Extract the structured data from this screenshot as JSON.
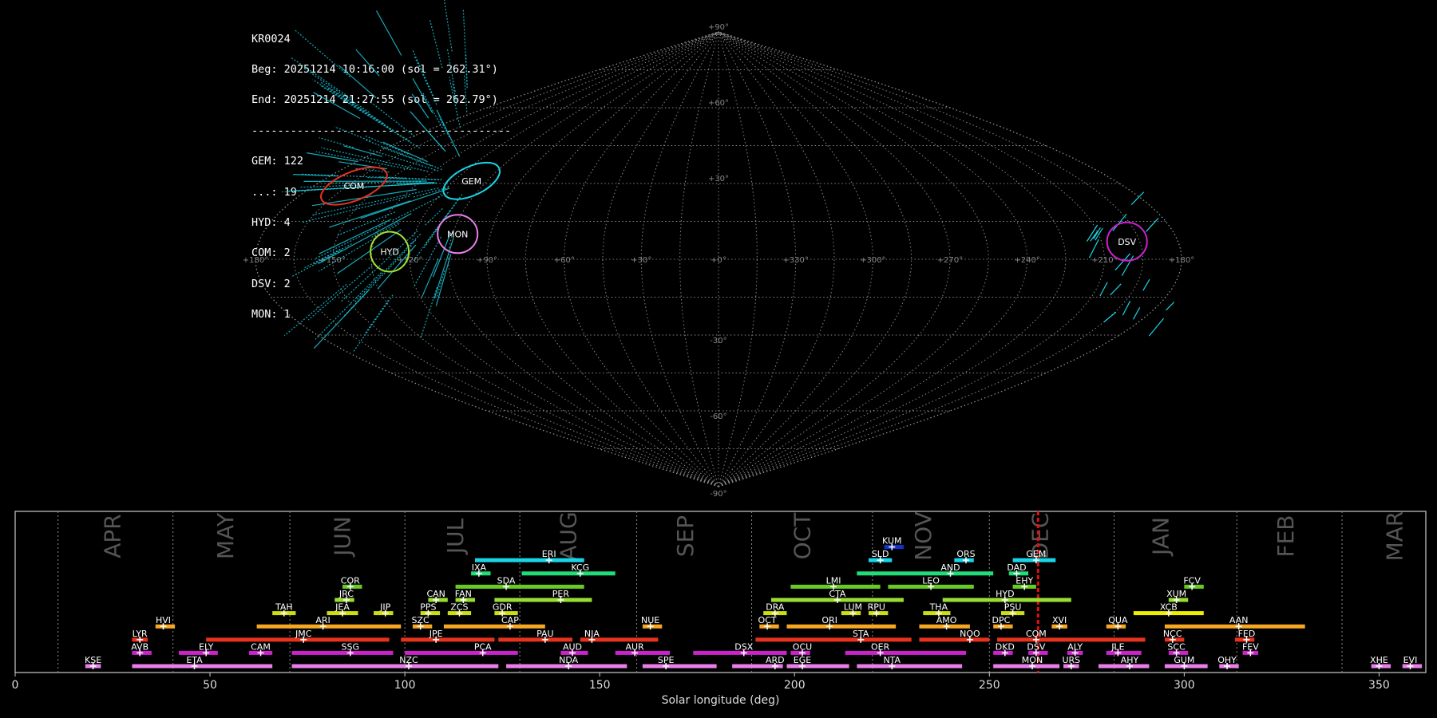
{
  "summary": {
    "camera": "KR0024",
    "beg": "Beg: 20251214 10:16:00 (sol = 262.31°)",
    "end": "End: 20251214 21:27:55 (sol = 262.79°)",
    "separator": "----------------------------------------",
    "counts": [
      "GEM: 122",
      "...: 19",
      "HYD: 4",
      "COM: 2",
      "DSV: 2",
      "MON: 1"
    ]
  },
  "sky_map": {
    "lat_labels": [
      "+90°",
      "+60°",
      "+30°",
      "-30°",
      "-60°",
      "-90°"
    ],
    "lon_labels": [
      "+180°",
      "+150°",
      "+120°",
      "+90°",
      "+60°",
      "+30°",
      "+0°",
      "+330°",
      "+300°",
      "+270°",
      "+240°",
      "+210°",
      "+180°"
    ],
    "radiants": [
      {
        "code": "COM",
        "ra": 162,
        "dec": 29,
        "color": "#e8321e"
      },
      {
        "code": "GEM",
        "ra": 112,
        "dec": 31,
        "color": "#19d4e6"
      },
      {
        "code": "MON",
        "ra": 103,
        "dec": 10,
        "color": "#e87ee8"
      },
      {
        "code": "HYD",
        "ra": 128,
        "dec": 3,
        "color": "#a6e22e"
      },
      {
        "code": "DSV",
        "ra": 200,
        "dec": 7,
        "color": "#cc22cc"
      }
    ]
  },
  "chart_data": {
    "type": "bar",
    "xlabel": "Solar longitude (deg)",
    "xlim": [
      0,
      362
    ],
    "x_ticks": [
      0,
      50,
      100,
      150,
      200,
      250,
      300,
      350
    ],
    "current_sol": 262.5,
    "months": [
      {
        "label": "APR",
        "x": 25
      },
      {
        "label": "MAY",
        "x": 54
      },
      {
        "label": "JUN",
        "x": 84
      },
      {
        "label": "JUL",
        "x": 113
      },
      {
        "label": "AUG",
        "x": 142
      },
      {
        "label": "SEP",
        "x": 172
      },
      {
        "label": "OCT",
        "x": 202
      },
      {
        "label": "NOV",
        "x": 233
      },
      {
        "label": "DEC",
        "x": 263
      },
      {
        "label": "JAN",
        "x": 294
      },
      {
        "label": "FEB",
        "x": 326
      },
      {
        "label": "MAR",
        "x": 354
      }
    ],
    "month_dividers": [
      11,
      40.5,
      70.5,
      100,
      129.5,
      159.5,
      189,
      220,
      250,
      282,
      313.5,
      340.5
    ],
    "showers": [
      {
        "code": "KUM",
        "start": 223,
        "end": 228,
        "peak": 225,
        "row": 10,
        "color": "#1133cc"
      },
      {
        "code": "ERI",
        "start": 118,
        "end": 146,
        "peak": 137,
        "row": 9,
        "color": "#19d4e6"
      },
      {
        "code": "SLD",
        "start": 219,
        "end": 225,
        "peak": 222,
        "row": 9,
        "color": "#19d4e6"
      },
      {
        "code": "ORS",
        "start": 241,
        "end": 246,
        "peak": 244,
        "row": 9,
        "color": "#19d4e6"
      },
      {
        "code": "GEM",
        "start": 256,
        "end": 267,
        "peak": 262,
        "row": 9,
        "color": "#19d4e6"
      },
      {
        "code": "IXA",
        "start": 117,
        "end": 122,
        "peak": 119,
        "row": 8,
        "color": "#22dd77"
      },
      {
        "code": "KCG",
        "start": 130,
        "end": 154,
        "peak": 145,
        "row": 8,
        "color": "#22dd77"
      },
      {
        "code": "AND",
        "start": 216,
        "end": 251,
        "peak": 240,
        "row": 8,
        "color": "#22dd77"
      },
      {
        "code": "DAD",
        "start": 255,
        "end": 260,
        "peak": 257,
        "row": 8,
        "color": "#22dd77"
      },
      {
        "code": "COR",
        "start": 84,
        "end": 89,
        "peak": 86,
        "row": 7,
        "color": "#66cc22"
      },
      {
        "code": "SDA",
        "start": 113,
        "end": 146,
        "peak": 126,
        "row": 7,
        "color": "#66cc22"
      },
      {
        "code": "LMI",
        "start": 199,
        "end": 222,
        "peak": 210,
        "row": 7,
        "color": "#66cc22"
      },
      {
        "code": "LEO",
        "start": 224,
        "end": 246,
        "peak": 235,
        "row": 7,
        "color": "#66cc22"
      },
      {
        "code": "EHY",
        "start": 256,
        "end": 262,
        "peak": 259,
        "row": 7,
        "color": "#66cc22"
      },
      {
        "code": "FCV",
        "start": 300,
        "end": 305,
        "peak": 302,
        "row": 7,
        "color": "#66cc22"
      },
      {
        "code": "JRC",
        "start": 82,
        "end": 87,
        "peak": 85,
        "row": 6,
        "color": "#99dd33"
      },
      {
        "code": "CAN",
        "start": 106,
        "end": 111,
        "peak": 108,
        "row": 6,
        "color": "#99dd33"
      },
      {
        "code": "FAN",
        "start": 113,
        "end": 118,
        "peak": 115,
        "row": 6,
        "color": "#99dd33"
      },
      {
        "code": "PER",
        "start": 123,
        "end": 148,
        "peak": 140,
        "row": 6,
        "color": "#99dd33"
      },
      {
        "code": "CTA",
        "start": 194,
        "end": 228,
        "peak": 211,
        "row": 6,
        "color": "#99dd33"
      },
      {
        "code": "HYD",
        "start": 238,
        "end": 271,
        "peak": 254,
        "row": 6,
        "color": "#99dd33"
      },
      {
        "code": "XUM",
        "start": 296,
        "end": 301,
        "peak": 298,
        "row": 6,
        "color": "#99dd33"
      },
      {
        "code": "TAH",
        "start": 66,
        "end": 72,
        "peak": 69,
        "row": 5,
        "color": "#ccdd11"
      },
      {
        "code": "JEA",
        "start": 80,
        "end": 88,
        "peak": 84,
        "row": 5,
        "color": "#ccdd11"
      },
      {
        "code": "JIP",
        "start": 92,
        "end": 97,
        "peak": 95,
        "row": 5,
        "color": "#ccdd11"
      },
      {
        "code": "PPS",
        "start": 104,
        "end": 109,
        "peak": 106,
        "row": 5,
        "color": "#ccdd11"
      },
      {
        "code": "ZCS",
        "start": 111,
        "end": 117,
        "peak": 114,
        "row": 5,
        "color": "#ccdd11"
      },
      {
        "code": "GDR",
        "start": 123,
        "end": 129,
        "peak": 125,
        "row": 5,
        "color": "#ccdd11"
      },
      {
        "code": "DRA",
        "start": 192,
        "end": 198,
        "peak": 195,
        "row": 5,
        "color": "#ccdd11"
      },
      {
        "code": "LUM",
        "start": 212,
        "end": 217,
        "peak": 215,
        "row": 5,
        "color": "#ccdd11"
      },
      {
        "code": "RPU",
        "start": 219,
        "end": 224,
        "peak": 221,
        "row": 5,
        "color": "#ccdd11"
      },
      {
        "code": "THA",
        "start": 233,
        "end": 240,
        "peak": 237,
        "row": 5,
        "color": "#ccdd11"
      },
      {
        "code": "PSU",
        "start": 253,
        "end": 259,
        "peak": 256,
        "row": 5,
        "color": "#ccdd11"
      },
      {
        "code": "XCB",
        "start": 287,
        "end": 305,
        "peak": 296,
        "row": 5,
        "color": "#eeee00"
      },
      {
        "code": "HVI",
        "start": 36,
        "end": 41,
        "peak": 38,
        "row": 4,
        "color": "#f5a623"
      },
      {
        "code": "ARI",
        "start": 62,
        "end": 99,
        "peak": 79,
        "row": 4,
        "color": "#f5a623"
      },
      {
        "code": "SZC",
        "start": 102,
        "end": 107,
        "peak": 104,
        "row": 4,
        "color": "#f5a623"
      },
      {
        "code": "CAP",
        "start": 110,
        "end": 136,
        "peak": 127,
        "row": 4,
        "color": "#f5a623"
      },
      {
        "code": "NUE",
        "start": 161,
        "end": 166,
        "peak": 163,
        "row": 4,
        "color": "#f5a623"
      },
      {
        "code": "OCT",
        "start": 191,
        "end": 196,
        "peak": 193,
        "row": 4,
        "color": "#f5a623"
      },
      {
        "code": "ORI",
        "start": 198,
        "end": 226,
        "peak": 209,
        "row": 4,
        "color": "#f5a623"
      },
      {
        "code": "AMO",
        "start": 232,
        "end": 245,
        "peak": 239,
        "row": 4,
        "color": "#f5a623"
      },
      {
        "code": "DPC",
        "start": 251,
        "end": 256,
        "peak": 253,
        "row": 4,
        "color": "#f5a623"
      },
      {
        "code": "XVI",
        "start": 266,
        "end": 270,
        "peak": 268,
        "row": 4,
        "color": "#f5a623"
      },
      {
        "code": "QUA",
        "start": 280,
        "end": 285,
        "peak": 283,
        "row": 4,
        "color": "#f5a623"
      },
      {
        "code": "AAN",
        "start": 295,
        "end": 331,
        "peak": 314,
        "row": 4,
        "color": "#f5a623"
      },
      {
        "code": "LYR",
        "start": 30,
        "end": 34,
        "peak": 32,
        "row": 3,
        "color": "#e8321e"
      },
      {
        "code": "JMC",
        "start": 49,
        "end": 96,
        "peak": 74,
        "row": 3,
        "color": "#e8321e"
      },
      {
        "code": "JPE",
        "start": 99,
        "end": 123,
        "peak": 108,
        "row": 3,
        "color": "#e8321e"
      },
      {
        "code": "PAU",
        "start": 124,
        "end": 143,
        "peak": 136,
        "row": 3,
        "color": "#e8321e"
      },
      {
        "code": "NIA",
        "start": 145,
        "end": 165,
        "peak": 148,
        "row": 3,
        "color": "#e8321e"
      },
      {
        "code": "STA",
        "start": 190,
        "end": 230,
        "peak": 217,
        "row": 3,
        "color": "#e8321e"
      },
      {
        "code": "NOO",
        "start": 232,
        "end": 250,
        "peak": 245,
        "row": 3,
        "color": "#e8321e"
      },
      {
        "code": "COM",
        "start": 252,
        "end": 290,
        "peak": 262,
        "row": 3,
        "color": "#e8321e"
      },
      {
        "code": "NCC",
        "start": 295,
        "end": 300,
        "peak": 297,
        "row": 3,
        "color": "#e8321e"
      },
      {
        "code": "FED",
        "start": 313,
        "end": 318,
        "peak": 316,
        "row": 3,
        "color": "#e8321e"
      },
      {
        "code": "AVB",
        "start": 30,
        "end": 35,
        "peak": 32,
        "row": 2,
        "color": "#cc22cc"
      },
      {
        "code": "ELY",
        "start": 42,
        "end": 52,
        "peak": 49,
        "row": 2,
        "color": "#cc22cc"
      },
      {
        "code": "CAM",
        "start": 60,
        "end": 66,
        "peak": 63,
        "row": 2,
        "color": "#cc22cc"
      },
      {
        "code": "SSG",
        "start": 71,
        "end": 97,
        "peak": 86,
        "row": 2,
        "color": "#cc22cc"
      },
      {
        "code": "PCA",
        "start": 100,
        "end": 129,
        "peak": 120,
        "row": 2,
        "color": "#cc22cc"
      },
      {
        "code": "AUD",
        "start": 140,
        "end": 147,
        "peak": 143,
        "row": 2,
        "color": "#cc22cc"
      },
      {
        "code": "AUR",
        "start": 154,
        "end": 168,
        "peak": 159,
        "row": 2,
        "color": "#cc22cc"
      },
      {
        "code": "DSX",
        "start": 174,
        "end": 198,
        "peak": 187,
        "row": 2,
        "color": "#cc22cc"
      },
      {
        "code": "OCU",
        "start": 199,
        "end": 204,
        "peak": 202,
        "row": 2,
        "color": "#cc22cc"
      },
      {
        "code": "OER",
        "start": 213,
        "end": 244,
        "peak": 222,
        "row": 2,
        "color": "#cc22cc"
      },
      {
        "code": "DKD",
        "start": 251,
        "end": 256,
        "peak": 254,
        "row": 2,
        "color": "#cc22cc"
      },
      {
        "code": "DSV",
        "start": 260,
        "end": 265,
        "peak": 262,
        "row": 2,
        "color": "#cc22cc"
      },
      {
        "code": "ALY",
        "start": 270,
        "end": 274,
        "peak": 272,
        "row": 2,
        "color": "#cc22cc"
      },
      {
        "code": "JLE",
        "start": 280,
        "end": 289,
        "peak": 283,
        "row": 2,
        "color": "#cc22cc"
      },
      {
        "code": "SCC",
        "start": 296,
        "end": 301,
        "peak": 298,
        "row": 2,
        "color": "#cc22cc"
      },
      {
        "code": "FEV",
        "start": 315,
        "end": 319,
        "peak": 317,
        "row": 2,
        "color": "#cc22cc"
      },
      {
        "code": "KSE",
        "start": 18,
        "end": 22,
        "peak": 20,
        "row": 1,
        "color": "#e87ee8"
      },
      {
        "code": "ETA",
        "start": 30,
        "end": 66,
        "peak": 46,
        "row": 1,
        "color": "#e87ee8"
      },
      {
        "code": "NZC",
        "start": 71,
        "end": 124,
        "peak": 101,
        "row": 1,
        "color": "#e87ee8"
      },
      {
        "code": "NDA",
        "start": 126,
        "end": 157,
        "peak": 142,
        "row": 1,
        "color": "#e87ee8"
      },
      {
        "code": "SPE",
        "start": 161,
        "end": 180,
        "peak": 167,
        "row": 1,
        "color": "#e87ee8"
      },
      {
        "code": "ARD",
        "start": 184,
        "end": 197,
        "peak": 195,
        "row": 1,
        "color": "#e87ee8"
      },
      {
        "code": "EGE",
        "start": 198,
        "end": 214,
        "peak": 202,
        "row": 1,
        "color": "#e87ee8"
      },
      {
        "code": "NTA",
        "start": 216,
        "end": 243,
        "peak": 225,
        "row": 1,
        "color": "#e87ee8"
      },
      {
        "code": "MON",
        "start": 251,
        "end": 268,
        "peak": 261,
        "row": 1,
        "color": "#e87ee8"
      },
      {
        "code": "URS",
        "start": 269,
        "end": 273,
        "peak": 271,
        "row": 1,
        "color": "#e87ee8"
      },
      {
        "code": "AHY",
        "start": 278,
        "end": 291,
        "peak": 286,
        "row": 1,
        "color": "#e87ee8"
      },
      {
        "code": "GUM",
        "start": 295,
        "end": 306,
        "peak": 300,
        "row": 1,
        "color": "#e87ee8"
      },
      {
        "code": "OHY",
        "start": 309,
        "end": 314,
        "peak": 311,
        "row": 1,
        "color": "#e87ee8"
      },
      {
        "code": "XHE",
        "start": 348,
        "end": 353,
        "peak": 350,
        "row": 1,
        "color": "#e87ee8"
      },
      {
        "code": "EVI",
        "start": 356,
        "end": 361,
        "peak": 358,
        "row": 1,
        "color": "#e87ee8"
      }
    ]
  }
}
